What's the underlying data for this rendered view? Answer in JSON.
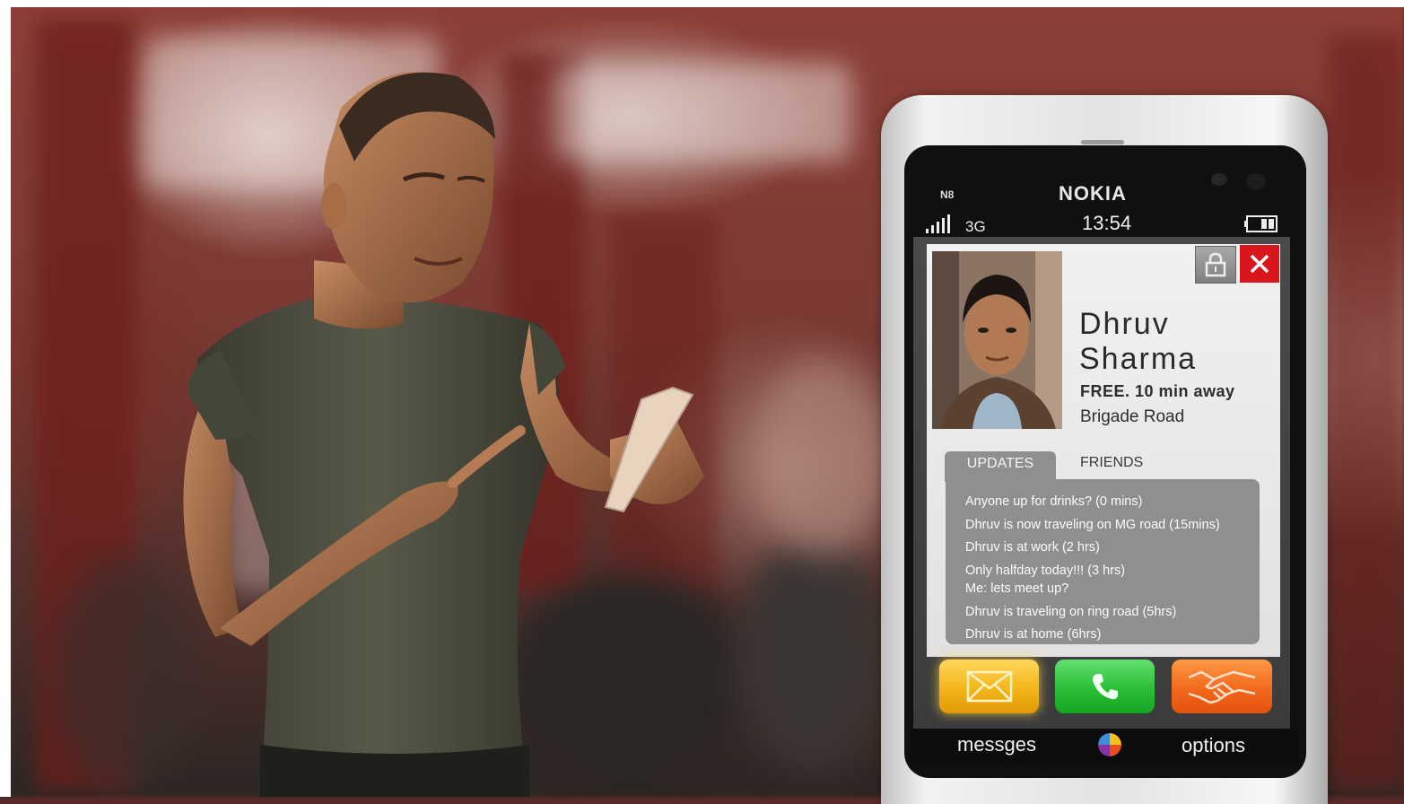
{
  "phone": {
    "model": "N8",
    "brand": "NOKIA",
    "network": "3G",
    "time": "13:54"
  },
  "contact": {
    "first_name": "Dhruv",
    "last_name": "Sharma",
    "status": "FREE. 10 min away",
    "location": "Brigade Road"
  },
  "tabs": [
    {
      "label": "UPDATES",
      "active": true
    },
    {
      "label": "FRIENDS",
      "active": false
    }
  ],
  "updates": [
    "Anyone up for drinks?  (0 mins)",
    "Dhruv is now traveling on MG road (15mins)",
    "Dhruv is at work (2 hrs)",
    "Only halfday today!!! (3 hrs)",
    "Me: lets meet up?",
    "Dhruv is traveling on ring road (5hrs)",
    "Dhruv is at home (6hrs)"
  ],
  "actions": {
    "message_icon": "envelope-icon",
    "call_icon": "phone-icon",
    "meet_icon": "handshake-icon"
  },
  "softkeys": {
    "left": "messges",
    "right": "options"
  },
  "colors": {
    "close": "#d9161b",
    "message": "#f3b51a",
    "call": "#2bbf36",
    "meet": "#f2681c"
  }
}
